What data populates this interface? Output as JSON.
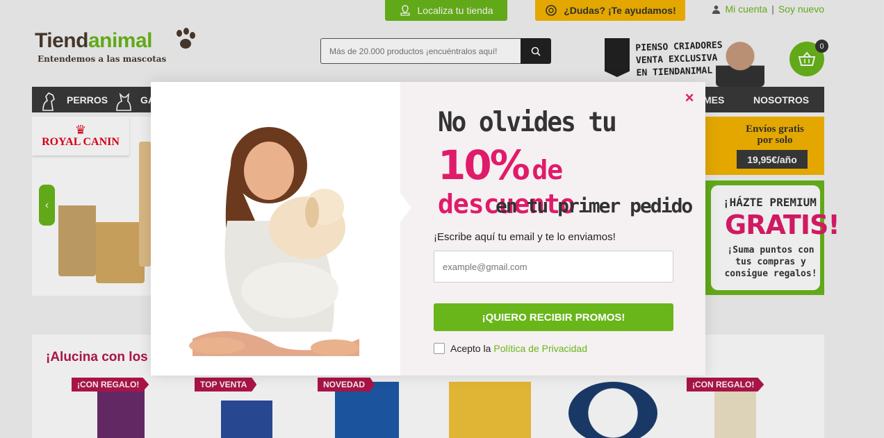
{
  "header": {
    "store_locator": "Localiza tu tienda",
    "help": "¿Dudas? ¡Te ayudamos!",
    "my_account": "Mi cuenta",
    "separator": "|",
    "new_user": "Soy nuevo",
    "cart_count": "0"
  },
  "logo": {
    "brand_part1": "Tiend",
    "brand_part2": "animal",
    "tagline": "Entendemos a las mascotas"
  },
  "search": {
    "placeholder": "Más de 20.000 productos ¡encuéntralos aquí!"
  },
  "promo_banner": {
    "line1": "PIENSO CRIADORES",
    "line2": "VENTA EXCLUSIVA",
    "line3": "EN TIENDANIMAL"
  },
  "nav": {
    "items": [
      {
        "label": "PERROS"
      },
      {
        "label": "GA"
      },
      {
        "label": "MES"
      },
      {
        "label": "NOSOTROS"
      }
    ]
  },
  "carousel": {
    "brand": "ROYAL CANIN"
  },
  "side_banners": {
    "shipping_line1": "Envíos gratis",
    "shipping_line2": "por solo",
    "shipping_price": "19,95€/año",
    "premium_line1": "¡HÁZTE PREMIUM",
    "premium_line2": "GRATIS!",
    "premium_line3": "¡Suma puntos con tus compras y consigue regalos!"
  },
  "products": {
    "heading": "¡Alucina con los T",
    "tags": [
      "¡CON REGALO!",
      "TOP VENTA",
      "NOVEDAD",
      "¡CON REGALO!"
    ]
  },
  "modal": {
    "headline1": "No olvides tu",
    "headline2_big": "10%",
    "headline2_rest": "de descuento",
    "headline3": "en tu primer pedido",
    "prompt": "¡Escribe aquí tu email y te lo enviamos!",
    "email_placeholder": "example@gmail.com",
    "cta": "¡QUIERO RECIBIR PROMOS!",
    "consent_prefix": "Acepto la",
    "consent_link": "Política de Privacidad",
    "close": "×"
  },
  "colors": {
    "brand_green": "#69b61a",
    "accent_pink": "#e01b6a",
    "help_yellow": "#f5b400",
    "nav_dark": "#3a3a3a"
  }
}
